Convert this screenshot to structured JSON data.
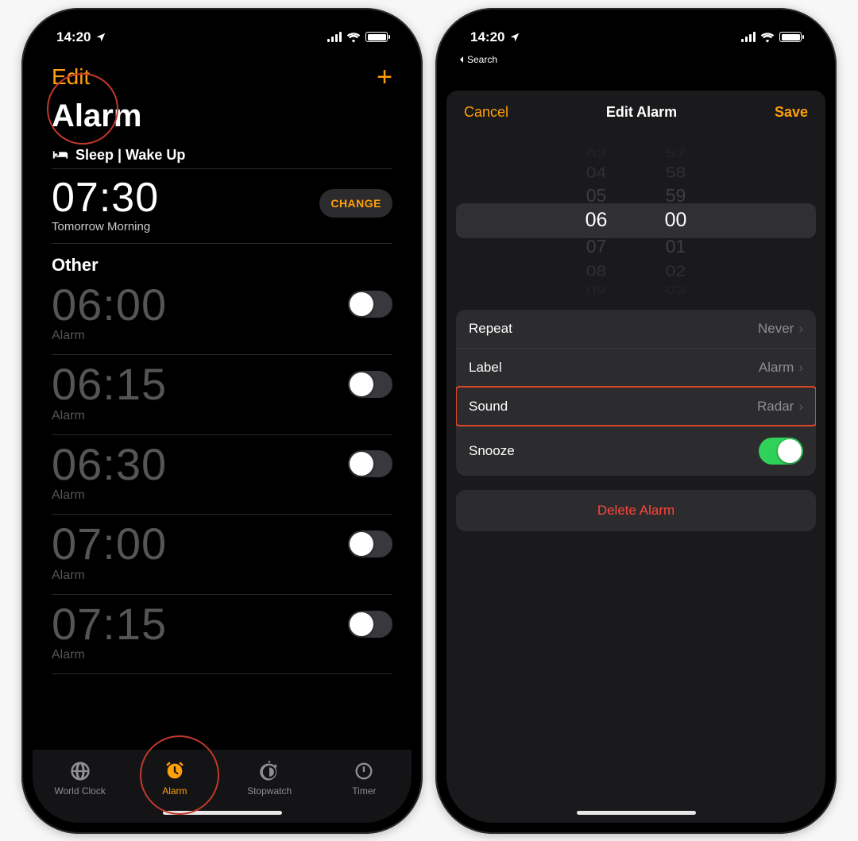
{
  "status": {
    "time": "14:20"
  },
  "left": {
    "back_label": "Search",
    "nav": {
      "edit": "Edit",
      "add": "+"
    },
    "title": "Alarm",
    "sleep": {
      "section": "Sleep | Wake Up",
      "time": "07:30",
      "subtitle": "Tomorrow Morning",
      "change": "CHANGE"
    },
    "other_title": "Other",
    "alarms": [
      {
        "time": "06:00",
        "label": "Alarm"
      },
      {
        "time": "06:15",
        "label": "Alarm"
      },
      {
        "time": "06:30",
        "label": "Alarm"
      },
      {
        "time": "07:00",
        "label": "Alarm"
      },
      {
        "time": "07:15",
        "label": "Alarm"
      }
    ],
    "tabs": {
      "world_clock": "World Clock",
      "alarm": "Alarm",
      "stopwatch": "Stopwatch",
      "timer": "Timer"
    }
  },
  "right": {
    "nav": {
      "cancel": "Cancel",
      "title": "Edit Alarm",
      "save": "Save"
    },
    "picker": {
      "hours": [
        "03",
        "04",
        "05",
        "06",
        "07",
        "08",
        "09"
      ],
      "mins": [
        "57",
        "58",
        "59",
        "00",
        "01",
        "02",
        "03"
      ]
    },
    "settings": {
      "repeat": {
        "label": "Repeat",
        "value": "Never"
      },
      "label": {
        "label": "Label",
        "value": "Alarm"
      },
      "sound": {
        "label": "Sound",
        "value": "Radar"
      },
      "snooze": {
        "label": "Snooze"
      }
    },
    "delete": "Delete Alarm"
  }
}
